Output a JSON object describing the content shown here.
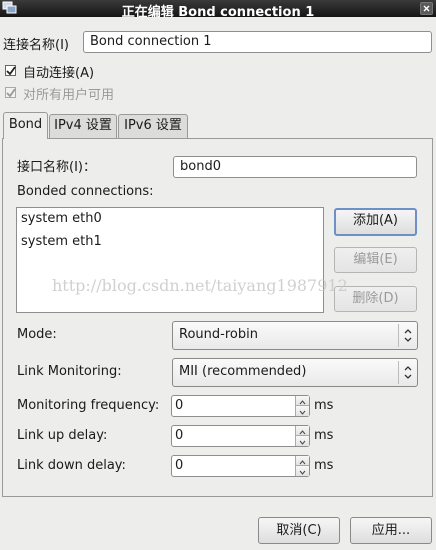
{
  "window": {
    "title": "正在编辑 Bond connection 1"
  },
  "connection": {
    "name_label": "连接名称(I)",
    "name_value": "Bond connection 1",
    "auto_connect_label": "自动连接(A)",
    "auto_connect_checked": true,
    "all_users_label": "对所有用户可用",
    "all_users_checked": true
  },
  "tabs": [
    {
      "label": "Bond",
      "active": true
    },
    {
      "label": "IPv4 设置",
      "active": false
    },
    {
      "label": "IPv6 设置",
      "active": false
    }
  ],
  "bond": {
    "interface_label": "接口名称(I)：",
    "interface_value": "bond0",
    "bonded_label": "Bonded connections:",
    "bonded_items": [
      "system eth0",
      "system eth1"
    ],
    "add_label": "添加(A)",
    "edit_label": "编辑(E)",
    "delete_label": "删除(D)",
    "mode_label": "Mode:",
    "mode_value": "Round-robin",
    "monitoring_label": "Link Monitoring:",
    "monitoring_value": "MII (recommended)",
    "frequency_label": "Monitoring frequency:",
    "frequency_value": "0",
    "updelay_label": "Link up delay:",
    "updelay_value": "0",
    "downdelay_label": "Link down delay:",
    "downdelay_value": "0",
    "unit_ms": "ms"
  },
  "watermark": "http://blog.csdn.net/taiyang1987912",
  "footer": {
    "cancel_label": "取消(C)",
    "apply_label": "应用..."
  }
}
